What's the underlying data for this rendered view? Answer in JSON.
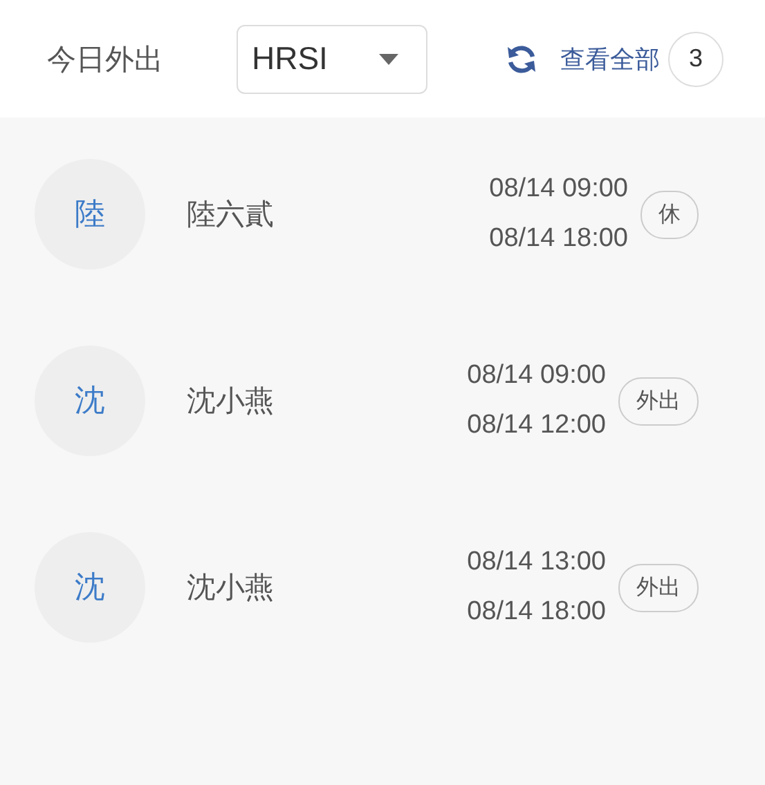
{
  "header": {
    "title": "今日外出",
    "dropdown": {
      "value": "HRSI"
    },
    "view_all": "查看全部",
    "count": "3"
  },
  "entries": [
    {
      "avatar": "陸",
      "name": "陸六貳",
      "start": "08/14 09:00",
      "end": "08/14 18:00",
      "tag": "休"
    },
    {
      "avatar": "沈",
      "name": "沈小燕",
      "start": "08/14 09:00",
      "end": "08/14 12:00",
      "tag": "外出"
    },
    {
      "avatar": "沈",
      "name": "沈小燕",
      "start": "08/14 13:00",
      "end": "08/14 18:00",
      "tag": "外出"
    }
  ]
}
